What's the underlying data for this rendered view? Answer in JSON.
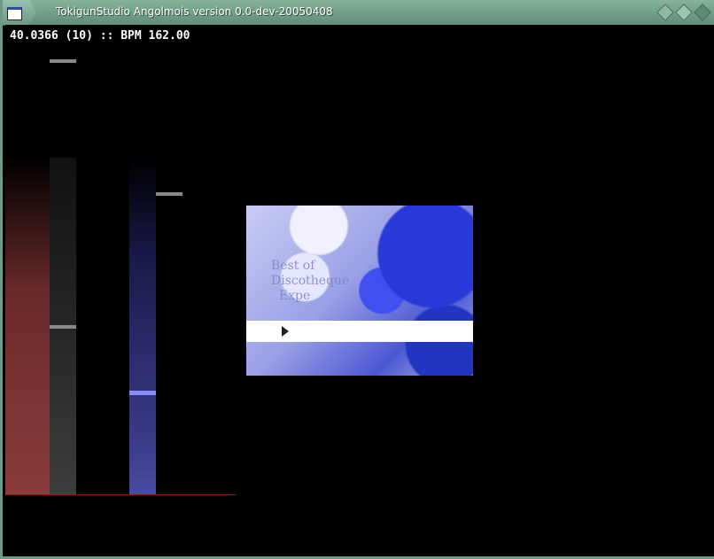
{
  "window": {
    "title": "TokigunStudio Angolmois version 0.0-dev-20050408",
    "icon": "window-icon",
    "controls": [
      "minimize-icon",
      "maximize-icon",
      "close-icon"
    ]
  },
  "hud": {
    "text": "40.0366 (10) :: BPM 162.00"
  },
  "playfield": {
    "lanes": [
      {
        "name": "lane-1",
        "color": "#8a3b3b"
      },
      {
        "name": "lane-2",
        "color": "#3d3d3d"
      },
      {
        "name": "lane-4",
        "color": "#4a4aa0"
      }
    ],
    "judge_line_color": "#8b1a1a",
    "note_colors": {
      "gray": "#8a8a8a",
      "blue": "#8a8aff"
    }
  },
  "bga": {
    "caption": "Best of\nDiscotheque\n  Expe",
    "play_icon": "play-icon"
  }
}
